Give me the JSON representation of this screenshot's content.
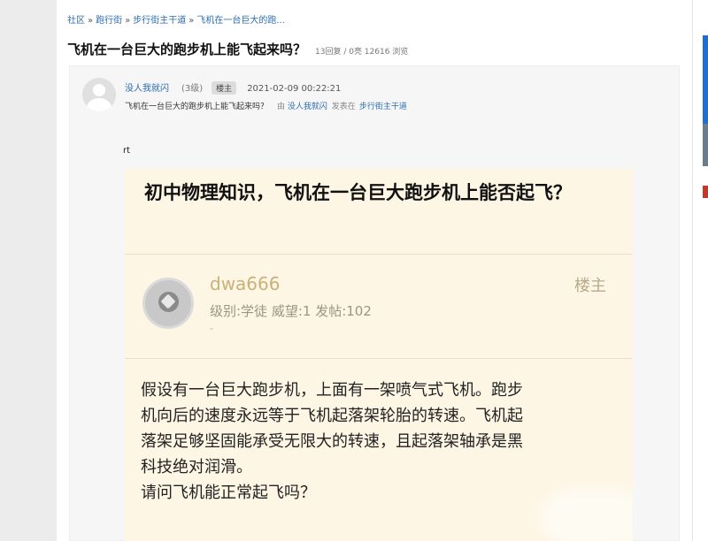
{
  "breadcrumb": {
    "items": [
      "社区",
      "跑行街",
      "步行街主干道",
      "飞机在一台巨大的跑..."
    ],
    "separator": "»"
  },
  "thread": {
    "title": "飞机在一台巨大的跑步机上能飞起来吗？",
    "stats": "13回复 / 0亮 12616 浏览"
  },
  "post": {
    "author": "没人我就闪",
    "level": "(3级)",
    "badge": "楼主",
    "time": "2021-02-09 00:22:21",
    "subline_title": "飞机在一台巨大的跑步机上能飞起来吗？",
    "subline_prefix": "由",
    "subline_author": "没人我就闪",
    "subline_mid": "发表在",
    "subline_section": "步行街主干道",
    "body_text": "rt"
  },
  "embedded_screenshot": {
    "title": "初中物理知识，飞机在一台巨大跑步机上能否起飞？",
    "username": "dwa666",
    "user_info": "级别:学徒 威望:1 发帖:102",
    "dash": "-",
    "louzhu": "楼主",
    "body_lines": [
      "假设有一台巨大跑步机，上面有一架喷气式飞机。跑步",
      "机向后的速度永远等于飞机起落架轮胎的转速。飞机起",
      "落架足够坚固能承受无限大的转速，且起落架轴承是黑",
      "科技绝对润滑。",
      "请问飞机能正常起飞吗？"
    ]
  },
  "colors": {
    "link": "#2b6cb0",
    "embedded_bg": "#fdf6e4",
    "username_gold": "#c9b27a"
  },
  "icons": {
    "user_avatar": "default-user-avatar-icon",
    "embedded_avatar": "diving-helmet-avatar-icon"
  }
}
